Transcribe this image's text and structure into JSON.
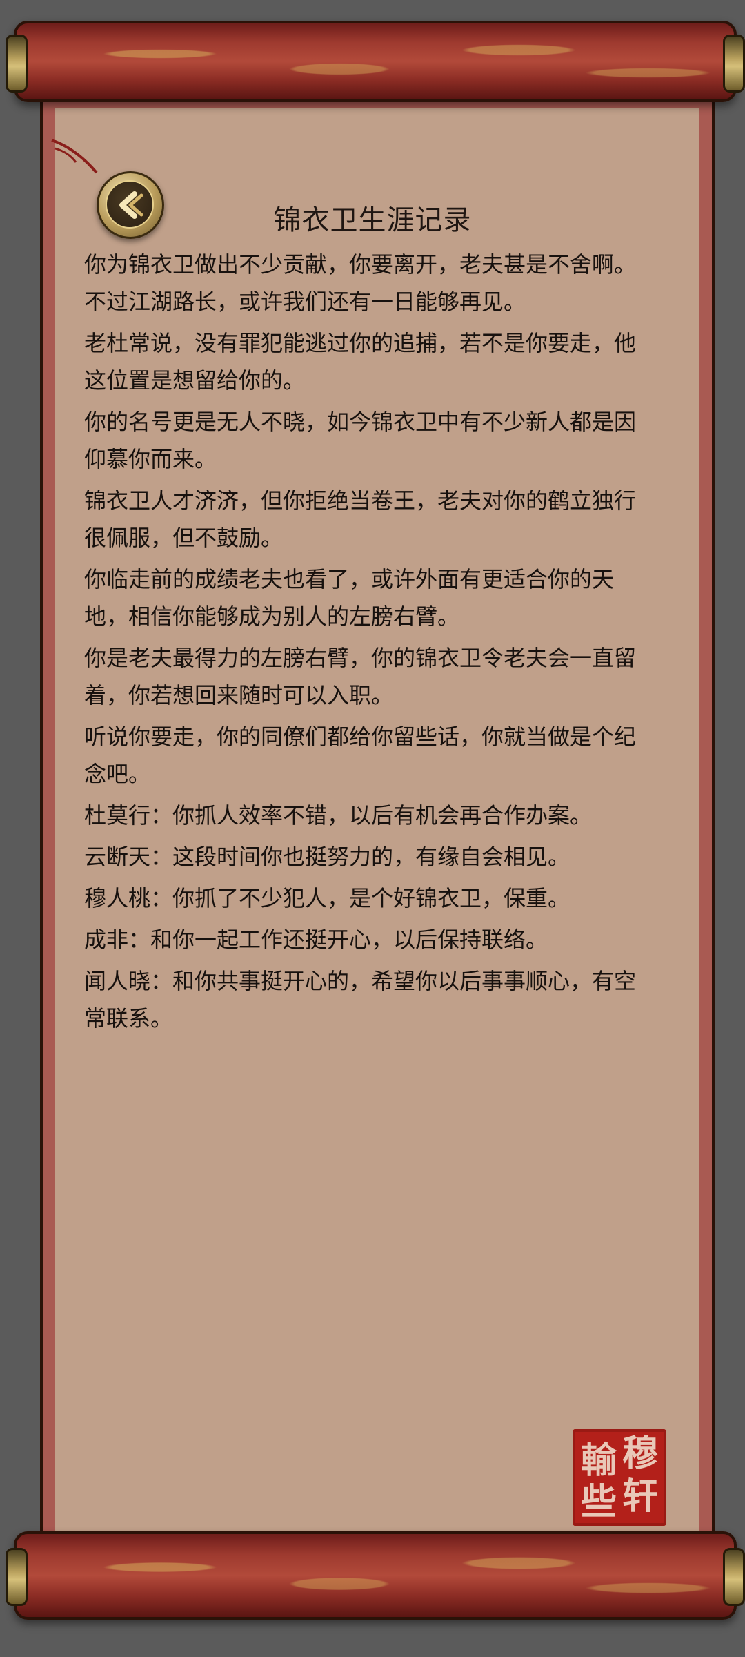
{
  "page": {
    "title": "锦衣卫生涯记录"
  },
  "paragraphs": [
    "你为锦衣卫做出不少贡献，你要离开，老夫甚是不舍啊。不过江湖路长，或许我们还有一日能够再见。",
    "老杜常说，没有罪犯能逃过你的追捕，若不是你要走，他这位置是想留给你的。",
    "你的名号更是无人不晓，如今锦衣卫中有不少新人都是因仰慕你而来。",
    "锦衣卫人才济济，但你拒绝当卷王，老夫对你的鹤立独行很佩服，但不鼓励。",
    "你临走前的成绩老夫也看了，或许外面有更适合你的天地，相信你能够成为别人的左膀右臂。",
    "你是老夫最得力的左膀右臂，你的锦衣卫令老夫会一直留着，你若想回来随时可以入职。",
    "听说你要走，你的同僚们都给你留些话，你就当做是个纪念吧。",
    "杜莫行：你抓人效率不错，以后有机会再合作办案。",
    "云断天：这段时间你也挺努力的，有缘自会相见。",
    "穆人桃：你抓了不少犯人，是个好锦衣卫，保重。",
    "成非：和你一起工作还挺开心，以后保持联络。",
    "闻人晓：和你共事挺开心的，希望你以后事事顺心，有空常联系。"
  ],
  "seal": {
    "chars": [
      "穆",
      "轩",
      "輸",
      "些"
    ]
  },
  "icons": {
    "back": "back-chevron-icon"
  },
  "colors": {
    "background": "#5b5b5b",
    "paper": "#c0a08a",
    "border": "#a95a52",
    "seal": "#b3201a"
  }
}
